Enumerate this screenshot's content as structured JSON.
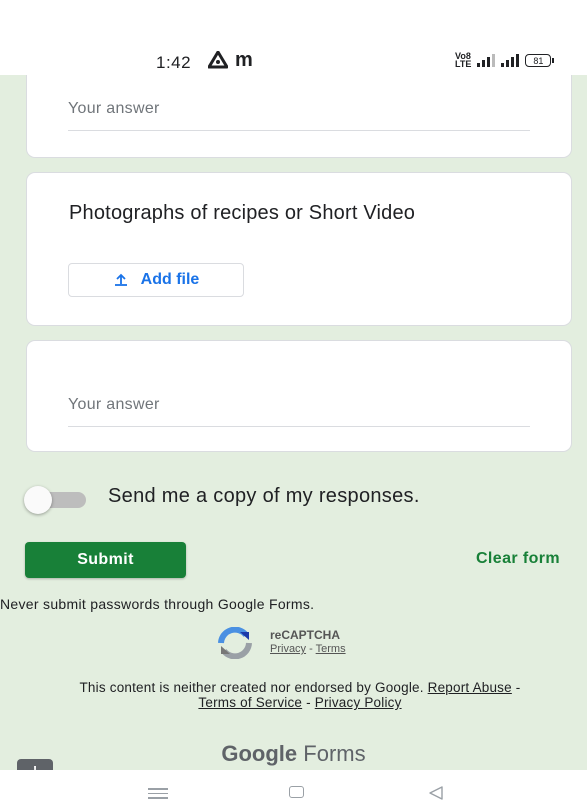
{
  "status_bar": {
    "time": "1:42",
    "carrier_icon": "m",
    "volte_label_top": "Vo8",
    "volte_label_bottom": "LTE",
    "battery": "81"
  },
  "form": {
    "answer_placeholder_1": "Your answer",
    "upload_question": "Photographs of recipes or Short Video",
    "add_file_label": "Add file",
    "answer_placeholder_2": "Your answer",
    "copy_toggle_label": "Send me a copy of my responses.",
    "copy_toggle_on": false,
    "submit_label": "Submit",
    "clear_label": "Clear form",
    "password_warning": "Never submit passwords through Google Forms."
  },
  "recaptcha": {
    "title": "reCAPTCHA",
    "privacy": "Privacy",
    "separator": " - ",
    "terms": "Terms"
  },
  "footer": {
    "disclaimer_text": "This content is neither created nor endorsed by Google.",
    "report_abuse": "Report Abuse",
    "dash": " - ",
    "terms_of_service": "Terms of Service",
    "privacy_policy": "Privacy Policy",
    "brand_google": "Google",
    "brand_forms": "Forms",
    "report_badge": "!"
  },
  "colors": {
    "background": "#e3eedf",
    "submit": "#188038",
    "link_blue": "#1a73e8"
  }
}
